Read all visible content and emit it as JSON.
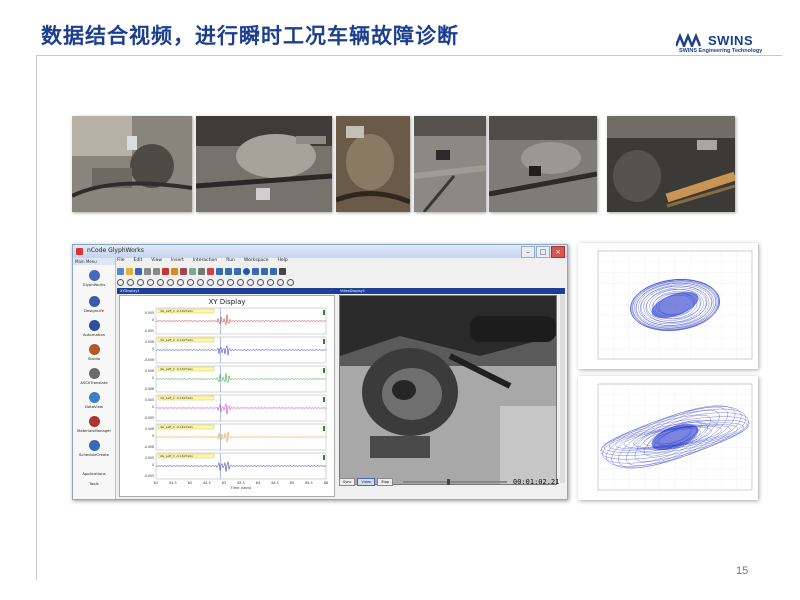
{
  "slide": {
    "title": "数据结合视频，进行瞬时工况车辆故障诊断",
    "page_number": "15"
  },
  "logo": {
    "wordmark": "SWINS",
    "tagline": "SWINS Engineering Technology",
    "brand_color": "#1b3e8f"
  },
  "photos": [
    {
      "name": "underbody-photo-1",
      "palette": "grey-brown"
    },
    {
      "name": "underbody-photo-2",
      "palette": "grey"
    },
    {
      "name": "underbody-photo-3",
      "palette": "brown"
    },
    {
      "name": "underbody-photo-4",
      "palette": "grey"
    },
    {
      "name": "underbody-photo-5",
      "palette": "grey"
    },
    {
      "name": "underbody-photo-6",
      "palette": "dark"
    }
  ],
  "app": {
    "window_title": "nCode GlyphWorks",
    "sidebar_header": "Main Menu",
    "sidebar_items": [
      {
        "label": "GlyphWorks",
        "icon": "gw-logo-icon",
        "color": "#4a68b8"
      },
      {
        "label": "DesignLife",
        "icon": "dl-logo-icon",
        "color": "#3b5aa8"
      },
      {
        "label": "Automation",
        "icon": "automation-icon",
        "color": "#2f4f9a"
      },
      {
        "label": "Studio",
        "icon": "studio-icon",
        "color": "#b05a2a"
      },
      {
        "label": "ASCIITranslate",
        "icon": "ascii-icon",
        "color": "#6a6a6a"
      },
      {
        "label": "DataView",
        "icon": "dataview-icon",
        "color": "#3d7fc1"
      },
      {
        "label": "MaterialsManager",
        "icon": "materials-icon",
        "color": "#a33"
      },
      {
        "label": "ScheduleCreate",
        "icon": "schedule-icon",
        "color": "#3a6ab4"
      },
      {
        "label": "Applications",
        "icon": "",
        "color": ""
      },
      {
        "label": "Tools",
        "icon": "",
        "color": ""
      }
    ],
    "menus": [
      "File",
      "Edit",
      "View",
      "Insert",
      "Interaction",
      "Run",
      "Workspace",
      "Help"
    ],
    "pane_left_title": "XYDisplay1",
    "pane_right_title": "VideoDisplay1",
    "graph": {
      "title": "XY Display",
      "xlabel": "Time (secs)",
      "xticks": [
        "61",
        "61.5",
        "62",
        "62.5",
        "63",
        "63.5",
        "64",
        "64.5",
        "65",
        "65.5",
        "66"
      ],
      "channels": [
        {
          "header": "4G_Left_C  -0.1627e0s",
          "color": "#d42020",
          "ymax": "0.005",
          "ymid": "0",
          "ymin": "-0.005"
        },
        {
          "header": "4G_Left_C  -0.1627e0s",
          "color": "#2030c8",
          "ymax": "0.006",
          "ymid": "0",
          "ymin": "-0.006"
        },
        {
          "header": "4G_Left_C  -0.1627e0s",
          "color": "#22a030",
          "ymax": "0.006",
          "ymid": "0",
          "ymin": "-0.006"
        },
        {
          "header": "4G_Left_C  -0.1627e0s",
          "color": "#d020d0",
          "ymax": "0.005",
          "ymid": "0",
          "ymin": "-0.005"
        },
        {
          "header": "4G_Left_C  -0.1627e0s",
          "color": "#f08a10",
          "ymax": "0.006",
          "ymid": "0",
          "ymin": "-0.006"
        },
        {
          "header": "4G_Left_C  -0.1627e0s",
          "color": "#2a2a8a",
          "ymax": "0.005",
          "ymid": "0",
          "ymin": "-0.005"
        }
      ]
    },
    "video": {
      "timecode": "00:01:02.21",
      "controls": [
        "Sync",
        "Video",
        "Stop"
      ],
      "active_control": "Video"
    }
  },
  "plots": [
    {
      "name": "orbit-plot-top",
      "color": "#2233cc"
    },
    {
      "name": "orbit-plot-bottom",
      "color": "#2233cc"
    }
  ]
}
